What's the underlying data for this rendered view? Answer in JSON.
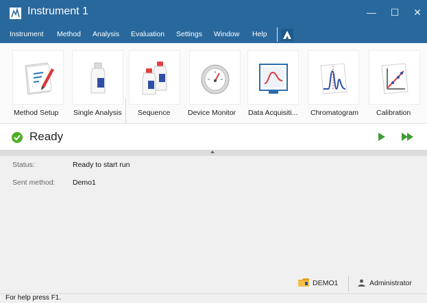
{
  "window": {
    "title": "Instrument 1",
    "controls": {
      "minimize": "—",
      "maximize": "☐",
      "close": "✕"
    }
  },
  "menu": {
    "items": [
      "Instrument",
      "Method",
      "Analysis",
      "Evaluation",
      "Settings",
      "Window",
      "Help"
    ]
  },
  "toolbar": {
    "tiles": [
      {
        "label": "Method Setup",
        "icon": "method-setup-icon"
      },
      {
        "label": "Single Analysis",
        "icon": "single-vial-icon"
      },
      {
        "label": "Sequence",
        "icon": "multiple-vials-icon"
      },
      {
        "label": "Device Monitor",
        "icon": "gauge-icon"
      },
      {
        "label": "Data Acquisiti...",
        "icon": "data-acquisition-icon"
      },
      {
        "label": "Chromatogram",
        "icon": "chromatogram-icon"
      },
      {
        "label": "Calibration",
        "icon": "calibration-icon"
      }
    ]
  },
  "ready": {
    "text": "Ready",
    "status_icon": "check-circle-icon",
    "run_icon": "play-icon",
    "run_all_icon": "fast-forward-icon"
  },
  "info": {
    "status_label": "Status:",
    "status_value": "Ready to start run",
    "method_label": "Sent method:",
    "method_value": "Demo1"
  },
  "footer": {
    "project": "DEMO1",
    "project_icon": "folder-icon",
    "user": "Administrator",
    "user_icon": "user-icon",
    "help": "For help press F1."
  },
  "colors": {
    "titlebar": "#29689c",
    "ready_green": "#4caf26",
    "run_green": "#3f9c35"
  }
}
